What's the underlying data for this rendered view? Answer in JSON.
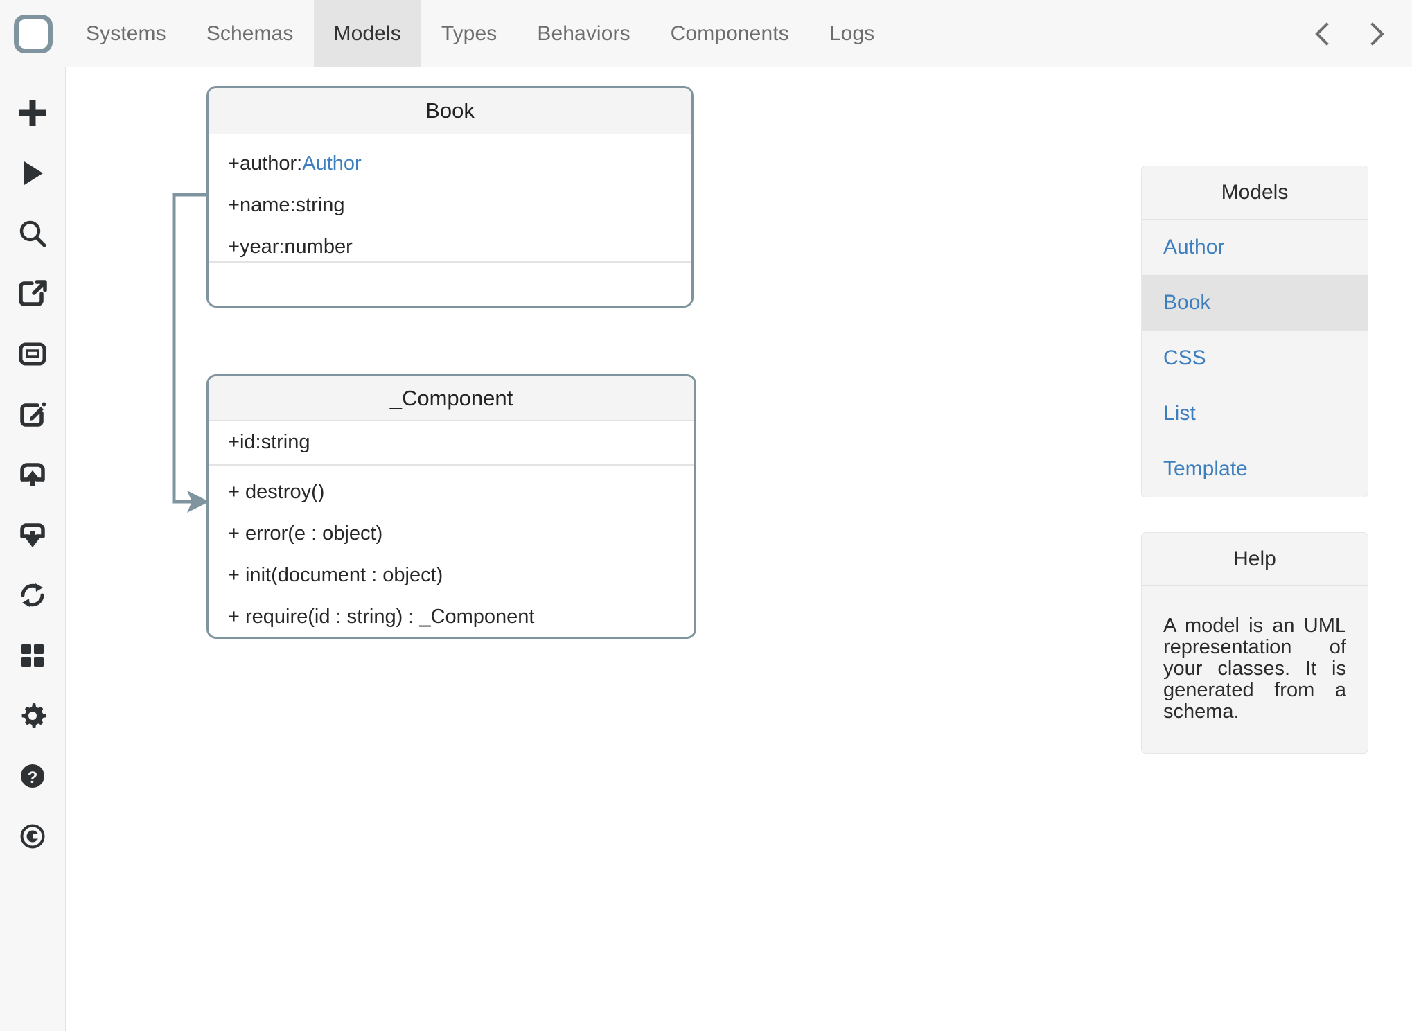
{
  "header": {
    "logo_icon": "rounded-square-logo",
    "tabs": [
      {
        "label": "Systems",
        "active": false
      },
      {
        "label": "Schemas",
        "active": false
      },
      {
        "label": "Models",
        "active": true
      },
      {
        "label": "Types",
        "active": false
      },
      {
        "label": "Behaviors",
        "active": false
      },
      {
        "label": "Components",
        "active": false
      },
      {
        "label": "Logs",
        "active": false
      }
    ],
    "nav_prev_icon": "chevron-left-icon",
    "nav_next_icon": "chevron-right-icon"
  },
  "rail": {
    "items": [
      {
        "icon": "plus-icon"
      },
      {
        "icon": "play-icon"
      },
      {
        "icon": "search-icon"
      },
      {
        "icon": "external-link-icon"
      },
      {
        "icon": "window-icon"
      },
      {
        "icon": "edit-square-icon"
      },
      {
        "icon": "upload-icon"
      },
      {
        "icon": "download-icon"
      },
      {
        "icon": "refresh-icon"
      },
      {
        "icon": "grid-icon"
      },
      {
        "icon": "gear-icon"
      },
      {
        "icon": "help-circle-icon"
      },
      {
        "icon": "copyright-icon"
      }
    ]
  },
  "diagram": {
    "classes": [
      {
        "name": "Book",
        "attributes": [
          {
            "prefix": "+ ",
            "name": "author",
            "sep": " : ",
            "type": "Author",
            "type_is_link": true
          },
          {
            "prefix": "+ ",
            "name": "name",
            "sep": " : ",
            "type": "string",
            "type_is_link": false
          },
          {
            "prefix": "+ ",
            "name": "year",
            "sep": " : ",
            "type": "number",
            "type_is_link": false
          }
        ],
        "operations": []
      },
      {
        "name": "_Component",
        "attributes": [
          {
            "prefix": "+ ",
            "name": "id",
            "sep": " : ",
            "type": "string",
            "type_is_link": false
          }
        ],
        "operations": [
          {
            "label": "+ destroy()"
          },
          {
            "label": "+ error(e : object)"
          },
          {
            "label": "+ init(document : object)"
          },
          {
            "label": "+ require(id : string) : _Component"
          }
        ]
      }
    ],
    "connector": {
      "from": "Book",
      "to": "_Component",
      "kind": "arrow"
    }
  },
  "right": {
    "models_panel": {
      "title": "Models",
      "items": [
        {
          "label": "Author",
          "selected": false
        },
        {
          "label": "Book",
          "selected": true
        },
        {
          "label": "CSS",
          "selected": false
        },
        {
          "label": "List",
          "selected": false
        },
        {
          "label": "Template",
          "selected": false
        }
      ]
    },
    "help_panel": {
      "title": "Help",
      "text": "A model is an UML representation of your classes. It is generated from a schema."
    }
  },
  "colors": {
    "uml_border": "#7f949e",
    "link": "#3d7ebf",
    "active_tab_bg": "#e4e4e4",
    "panel_bg": "#f4f4f4",
    "selected_item_bg": "#e3e3e3"
  }
}
